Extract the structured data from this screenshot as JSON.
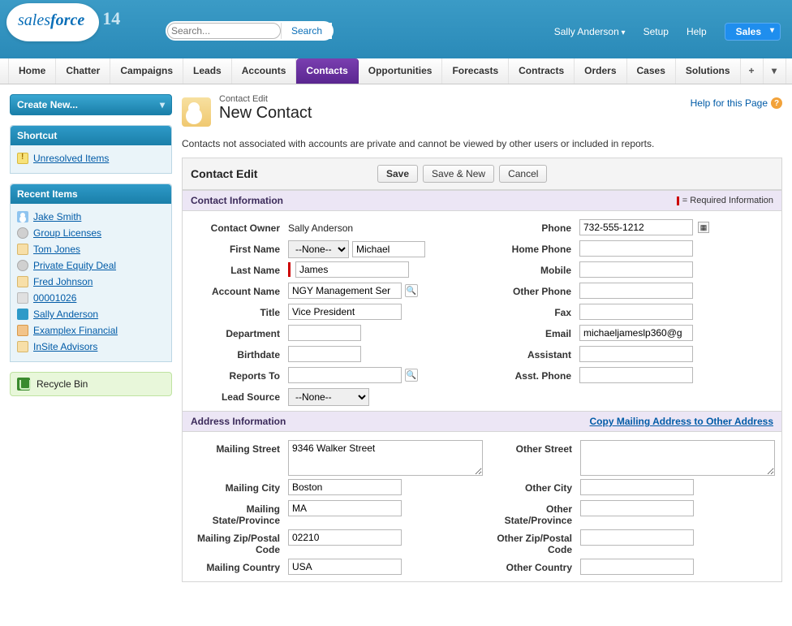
{
  "header": {
    "logo_prefix": "sales",
    "logo_suffix": "force",
    "logo_badge": "14",
    "search_placeholder": "Search...",
    "search_button": "Search",
    "user_name": "Sally Anderson",
    "setup": "Setup",
    "help": "Help",
    "app_name": "Sales"
  },
  "tabs": [
    "Home",
    "Chatter",
    "Campaigns",
    "Leads",
    "Accounts",
    "Contacts",
    "Opportunities",
    "Forecasts",
    "Contracts",
    "Orders",
    "Cases",
    "Solutions"
  ],
  "active_tab": "Contacts",
  "sidebar": {
    "create_new": "Create New...",
    "shortcut_title": "Shortcut",
    "shortcut_items": [
      "Unresolved Items"
    ],
    "recent_title": "Recent Items",
    "recent_items": [
      {
        "label": "Jake Smith",
        "icon": "person"
      },
      {
        "label": "Group Licenses",
        "icon": "dvd"
      },
      {
        "label": "Tom Jones",
        "icon": "file"
      },
      {
        "label": "Private Equity Deal",
        "icon": "dvd"
      },
      {
        "label": "Fred Johnson",
        "icon": "file"
      },
      {
        "label": "00001026",
        "icon": "numb"
      },
      {
        "label": "Sally Anderson",
        "icon": "userblue"
      },
      {
        "label": "Examplex Financial",
        "icon": "org"
      },
      {
        "label": "InSite Advisors",
        "icon": "file"
      }
    ],
    "recycle": "Recycle Bin"
  },
  "page": {
    "eyebrow": "Contact Edit",
    "title": "New Contact",
    "help": "Help for this Page",
    "intro": "Contacts not associated with accounts are private and cannot be viewed by other users or included in reports."
  },
  "form": {
    "block_title": "Contact Edit",
    "save": "Save",
    "save_new": "Save & New",
    "cancel": "Cancel",
    "section1": "Contact Information",
    "required_note": "= Required Information",
    "section2": "Address Information",
    "copy_link": "Copy Mailing Address to Other Address",
    "labels": {
      "owner": "Contact Owner",
      "first": "First Name",
      "last": "Last Name",
      "acct": "Account Name",
      "title": "Title",
      "dept": "Department",
      "bday": "Birthdate",
      "reports": "Reports To",
      "lead": "Lead Source",
      "phone": "Phone",
      "hphone": "Home Phone",
      "mobile": "Mobile",
      "ophone": "Other Phone",
      "fax": "Fax",
      "email": "Email",
      "asst": "Assistant",
      "aphone": "Asst. Phone",
      "mstreet": "Mailing Street",
      "mcity": "Mailing City",
      "mstate": "Mailing State/Province",
      "mzip": "Mailing Zip/Postal Code",
      "mctry": "Mailing Country",
      "ostreet": "Other Street",
      "ocity": "Other City",
      "ostate": "Other State/Province",
      "ozip": "Other Zip/Postal Code",
      "octry": "Other Country"
    },
    "values": {
      "owner": "Sally Anderson",
      "salutation": "--None--",
      "first": "Michael",
      "last": "James",
      "acct": "NGY Management Ser",
      "title": "Vice President",
      "dept": "",
      "bday": "",
      "reports": "",
      "lead": "--None--",
      "phone": "732-555-1212",
      "hphone": "",
      "mobile": "",
      "ophone": "",
      "fax": "",
      "email": "michaeljameslp360@g",
      "asst": "",
      "aphone": "",
      "mstreet": "9346 Walker Street",
      "mcity": "Boston",
      "mstate": "MA",
      "mzip": "02210",
      "mctry": "USA",
      "ostreet": "",
      "ocity": "",
      "ostate": "",
      "ozip": "",
      "octry": ""
    }
  }
}
